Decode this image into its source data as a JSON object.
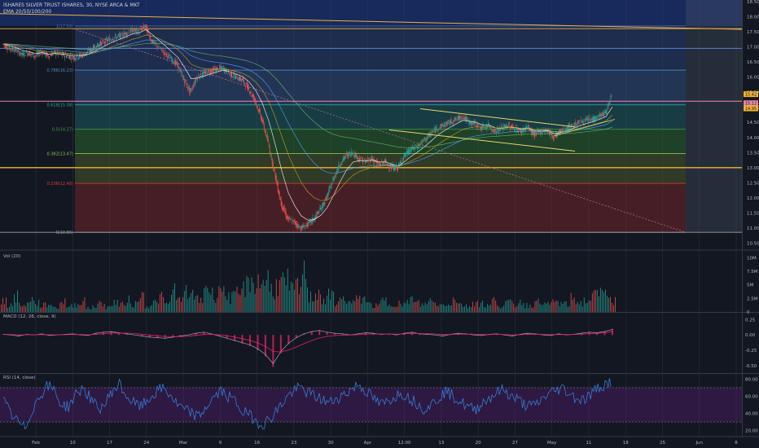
{
  "header": {
    "symbol": "ISHARES SILVER TRUST ISHARES, 30, NYSE ARCA & MKT",
    "ema_label": "EMA 20/50/100/200"
  },
  "panes": {
    "vol": "Vol (20)",
    "macd": "MACD (12, 26, close, 9)",
    "rsi": "RSI (14, close)"
  },
  "colors": {
    "background": "#131722",
    "grid": "#2a2e39",
    "candle_up": "#26a69a",
    "candle_down": "#ef5350",
    "trendline": "#e8d56b",
    "rsi_line": "#3a7bd5",
    "macd_line": "#9aa3b5",
    "signal_line": "#e91e63"
  },
  "chart_data": [
    {
      "type": "line",
      "name": "price",
      "price_axis": {
        "ticks": [
          "18.50",
          "18.00",
          "17.50",
          "17.00",
          "16.50",
          "16.00",
          "15.50",
          "15.00",
          "14.50",
          "14.00",
          "13.50",
          "13.00",
          "12.50",
          "12.00",
          "11.50",
          "11.00",
          "10.50"
        ],
        "ylim": [
          10.3,
          18.55
        ]
      },
      "price_badges": [
        "15.42",
        "15.12",
        "14.95"
      ],
      "time_axis": [
        "Feb",
        "10",
        "17",
        "24",
        "Mar",
        "9",
        "16",
        "23",
        "30",
        "Apr",
        "12:00",
        "13",
        "20",
        "27",
        "May",
        "11",
        "18",
        "25",
        "Jun",
        "8"
      ],
      "fib_levels": [
        {
          "label": "1(17.69)",
          "value": 17.69,
          "color": "#4a6fb5"
        },
        {
          "label": "0.786(16.23)",
          "value": 16.23,
          "color": "#4f86c6"
        },
        {
          "label": "0.618(15.08)",
          "value": 15.08,
          "color": "#26a69a"
        },
        {
          "label": "0.5(14.27)",
          "value": 14.27,
          "color": "#43a047"
        },
        {
          "label": "0.382(13.47)",
          "value": 13.47,
          "color": "#8bc34a"
        },
        {
          "label": "0.236(12.48)",
          "value": 12.48,
          "color": "#e53935"
        },
        {
          "label": "0(10.86)",
          "value": 10.86,
          "color": "#9aa0ab"
        }
      ],
      "horizontal_lines": [
        17.6,
        16.95,
        15.2,
        13.0,
        10.86
      ],
      "price_series": [
        17.1,
        16.95,
        16.9,
        16.75,
        16.8,
        16.7,
        16.85,
        16.7,
        16.8,
        16.75,
        16.7,
        16.65,
        16.7,
        16.8,
        16.95,
        17.1,
        17.2,
        17.3,
        17.35,
        17.45,
        17.55,
        17.5,
        17.7,
        17.2,
        17.0,
        16.8,
        16.6,
        16.4,
        15.9,
        15.5,
        16.0,
        16.1,
        16.2,
        16.25,
        16.3,
        16.1,
        16.0,
        15.9,
        15.6,
        15.2,
        14.6,
        13.8,
        12.8,
        11.8,
        11.3,
        11.2,
        11.0,
        11.1,
        11.3,
        11.6,
        12.0,
        12.6,
        13.1,
        13.4,
        13.5,
        13.3,
        13.2,
        13.3,
        13.1,
        13.2,
        13.0,
        13.0,
        13.4,
        13.6,
        13.7,
        13.9,
        14.1,
        14.3,
        14.4,
        14.5,
        14.6,
        14.7,
        14.5,
        14.45,
        14.3,
        14.4,
        14.2,
        14.3,
        14.4,
        14.3,
        14.2,
        14.35,
        14.1,
        14.2,
        14.25,
        14.0,
        14.2,
        14.3,
        14.4,
        14.5,
        14.55,
        14.6,
        14.7,
        14.8,
        15.4
      ]
    },
    {
      "type": "bar",
      "name": "volume",
      "ticks": [
        "10M",
        "7.5M",
        "5M",
        "2.5M",
        "0"
      ],
      "ylim": [
        0,
        10.5
      ],
      "values": [
        3.0,
        2.0,
        4.0,
        1.5,
        3.5,
        2.5,
        1.8,
        2.2,
        1.2,
        2.8,
        1.5,
        2.0,
        3.2,
        1.0,
        1.6,
        2.4,
        1.3,
        2.7,
        1.9,
        3.1,
        2.2,
        4.5,
        1.7,
        2.5,
        3.8,
        2.1,
        6.2,
        3.0,
        5.5,
        4.1,
        3.3,
        7.0,
        4.8,
        6.5,
        5.0,
        3.9,
        4.7,
        6.9,
        8.5,
        7.8,
        9.0,
        6.2,
        7.4,
        8.0,
        5.8,
        6.6,
        9.8,
        4.0,
        5.5,
        3.0,
        4.4,
        2.8,
        3.6,
        2.5,
        3.2,
        4.0,
        2.0,
        1.6,
        3.0,
        2.2,
        2.6,
        1.8,
        3.5,
        2.4,
        2.0,
        3.0,
        2.4,
        1.9,
        2.6,
        3.4,
        2.0,
        1.5,
        2.8,
        2.3,
        1.7,
        3.1,
        1.6,
        2.5,
        2.0,
        2.9,
        1.8,
        2.2,
        3.5,
        1.9,
        2.8,
        2.4,
        2.0,
        3.6,
        2.5,
        3.0,
        4.2,
        5.0,
        7.2,
        3.0
      ]
    },
    {
      "type": "line",
      "name": "macd",
      "ticks": [
        "0.25",
        "0.00",
        "-0.25",
        "-0.50"
      ],
      "ylim": [
        -0.62,
        0.36
      ],
      "values": [
        0.01,
        0.0,
        -0.02,
        0.01,
        0.0,
        0.02,
        -0.01,
        0.0,
        0.01,
        0.02,
        0.0,
        -0.01,
        0.03,
        0.05,
        0.06,
        0.04,
        0.02,
        0.0,
        -0.02,
        -0.04,
        -0.05,
        -0.06,
        -0.04,
        -0.02,
        0.0,
        0.03,
        0.05,
        0.02,
        -0.02,
        -0.06,
        -0.1,
        -0.14,
        -0.18,
        -0.25,
        -0.35,
        -0.52,
        -0.3,
        -0.15,
        -0.05,
        0.02,
        0.06,
        0.08,
        0.05,
        0.03,
        0.02,
        0.0,
        0.02,
        0.04,
        0.03,
        0.01,
        0.02,
        0.0,
        0.03,
        0.05,
        0.02,
        0.01,
        0.0,
        -0.02,
        0.01,
        0.03,
        0.02,
        0.0,
        -0.01,
        0.01,
        0.02,
        0.0,
        -0.02,
        0.01,
        0.03,
        0.02,
        0.0,
        -0.01,
        0.02,
        0.0,
        0.01,
        0.03,
        0.05,
        0.04,
        0.06,
        0.1
      ]
    },
    {
      "type": "line",
      "name": "rsi",
      "ticks": [
        "80.00",
        "60.00",
        "40.00",
        "20.00"
      ],
      "ylim": [
        14,
        86
      ],
      "values": [
        55,
        40,
        30,
        22,
        45,
        60,
        72,
        68,
        50,
        48,
        62,
        70,
        58,
        45,
        50,
        66,
        74,
        60,
        52,
        48,
        56,
        64,
        70,
        62,
        50,
        44,
        40,
        36,
        48,
        58,
        66,
        60,
        54,
        42,
        38,
        30,
        28,
        36,
        46,
        58,
        66,
        70,
        64,
        60,
        56,
        52,
        58,
        62,
        68,
        74,
        66,
        58,
        50,
        54,
        60,
        64,
        58,
        52,
        46,
        50,
        58,
        66,
        60,
        54,
        48,
        44,
        52,
        58,
        64,
        68,
        60,
        56,
        50,
        48,
        54,
        62,
        66,
        70,
        64,
        58,
        56,
        62,
        70,
        74,
        78
      ]
    }
  ]
}
